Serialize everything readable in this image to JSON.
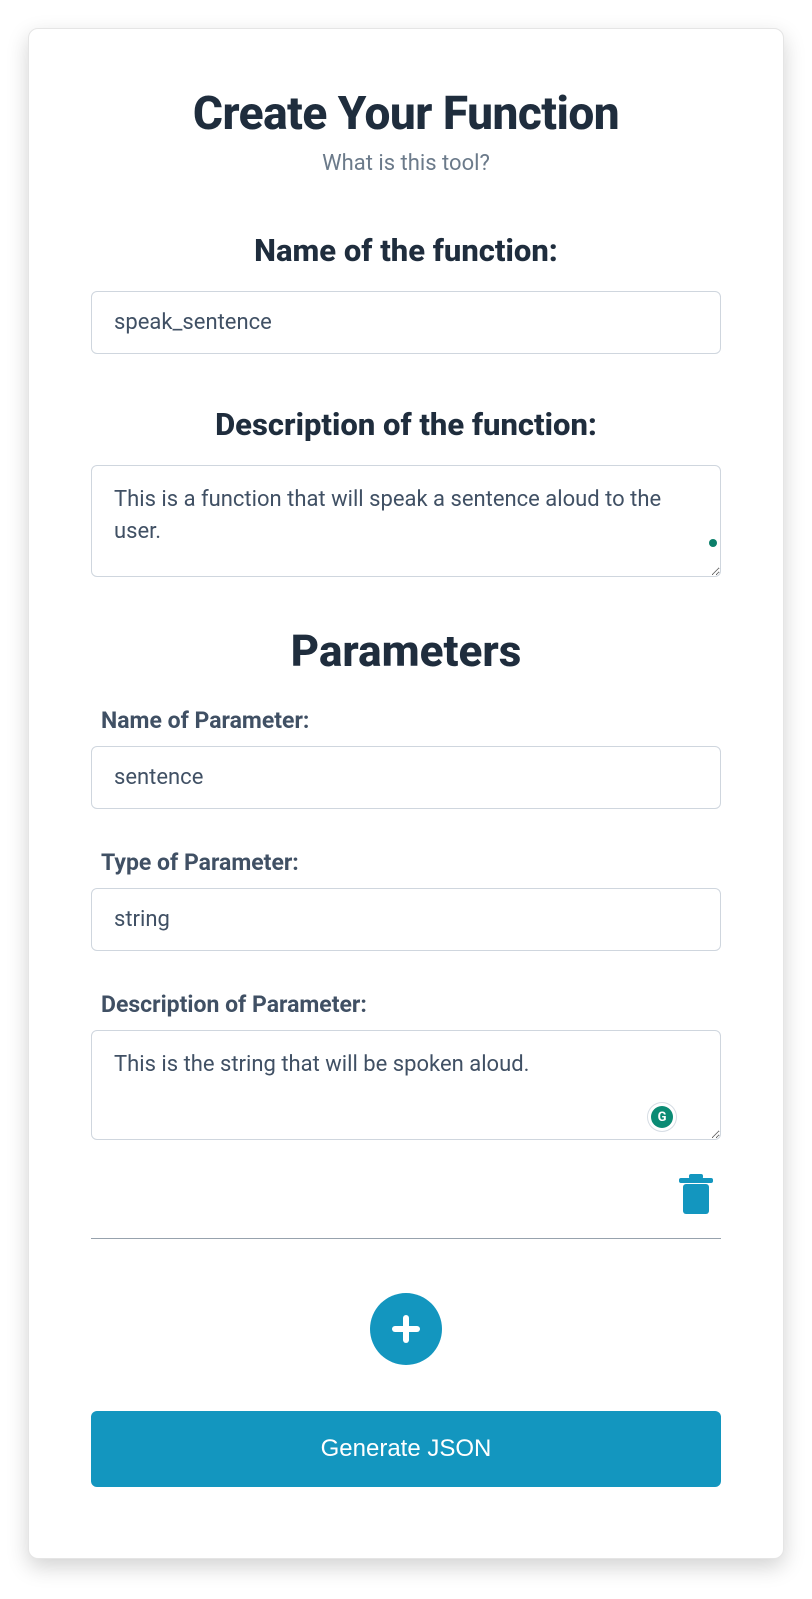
{
  "header": {
    "title": "Create Your Function",
    "subtitle": "What is this tool?"
  },
  "function_name": {
    "label": "Name of the function:",
    "value": "speak_sentence"
  },
  "function_description": {
    "label": "Description of the function:",
    "value": "This is a function that will speak a sentence aloud to the user."
  },
  "parameters_heading": "Parameters",
  "param_labels": {
    "name": "Name of Parameter:",
    "type": "Type of Parameter:",
    "description": "Description of Parameter:"
  },
  "parameters": [
    {
      "name": "sentence",
      "type": "string",
      "description": "This is the string that will be spoken aloud."
    }
  ],
  "buttons": {
    "generate": "Generate JSON"
  },
  "colors": {
    "accent": "#1396bf",
    "heading": "#1f2d3d",
    "muted": "#6b7a8a",
    "label": "#405064"
  }
}
